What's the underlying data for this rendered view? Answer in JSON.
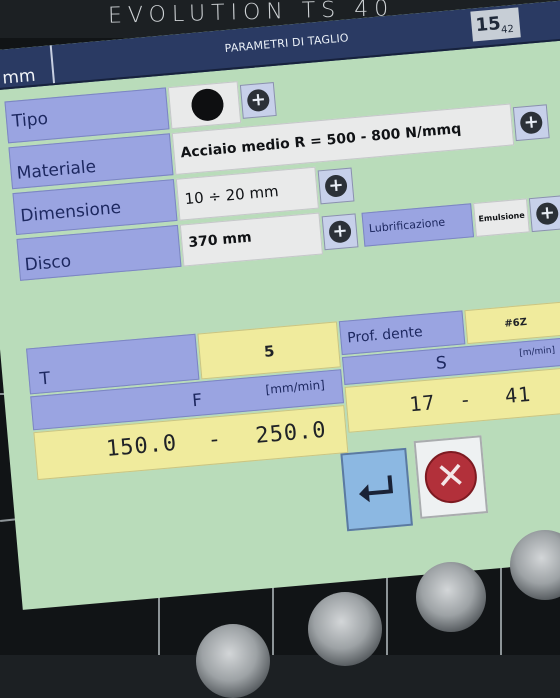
{
  "brand": "EVOLUTION TS 40",
  "header": {
    "unit": "mm",
    "title": "PARAMETRI DI TAGLIO",
    "clock_hour": "15",
    "clock_min": "42"
  },
  "form": {
    "tipo_label": "Tipo",
    "materiale_label": "Materiale",
    "materiale_value": "Acciaio medio R = 500 - 800 N/mmq",
    "dimensione_label": "Dimensione",
    "dimensione_value": "10 ÷ 20 mm",
    "disco_label": "Disco",
    "disco_value": "370 mm",
    "lubrificazione_label": "Lubrificazione",
    "lubrificazione_value": "Emulsione"
  },
  "params": {
    "t_label": "T",
    "t_value": "5",
    "prof_dente_label": "Prof. dente",
    "prof_dente_value": "#6Z",
    "s_label": "S",
    "s_unit": "[m/min]",
    "s_min": "17",
    "s_dash": "-",
    "s_max": "41",
    "f_label": "F",
    "f_unit": "[mm/min]",
    "f_min": "150.0",
    "f_dash": "-",
    "f_max": "250.0"
  },
  "icons": {
    "plus": "plus-icon",
    "enter": "enter-icon",
    "cancel": "cancel-icon"
  },
  "colors": {
    "screen_bg": "#b9dcba",
    "label_bg": "#9aa4e1",
    "value_bg": "#e9eaea",
    "readout_bg": "#f0eb9d",
    "titlebar_bg": "#2a3a63",
    "cancel_red": "#b2303a"
  }
}
